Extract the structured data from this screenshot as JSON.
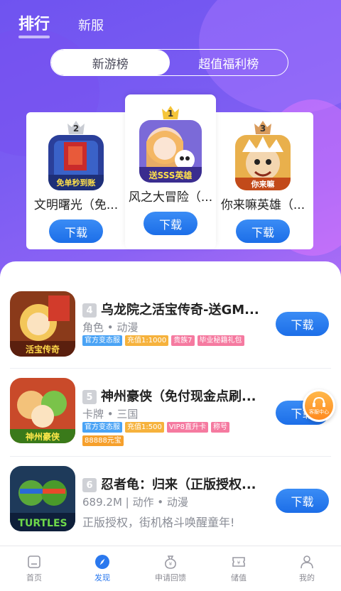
{
  "header": {
    "tab_active": "排行",
    "tab_other": "新服"
  },
  "segment": {
    "left": "新游榜",
    "right": "超值福利榜"
  },
  "podium": [
    {
      "rank": "2",
      "name": "文明曙光（免...",
      "button": "下载",
      "icon_text": "免单秒到账"
    },
    {
      "rank": "1",
      "name": "风之大冒险（...",
      "button": "下载",
      "icon_text": "送SSS英雄"
    },
    {
      "rank": "3",
      "name": "你来嘛英雄（...",
      "button": "下载",
      "icon_text": "你来嘛"
    }
  ],
  "list": [
    {
      "rank": "4",
      "title": "乌龙院之活宝传奇-送GM...",
      "sub": "角色 • 动漫",
      "tags": [
        {
          "text": "官方变态服",
          "color": "#4aa3f5"
        },
        {
          "text": "充值1:1000",
          "color": "#f6b23c"
        },
        {
          "text": "贵族7",
          "color": "#f57aa0"
        },
        {
          "text": "毕业秘籍礼包",
          "color": "#f57aa0"
        }
      ],
      "button": "下载"
    },
    {
      "rank": "5",
      "title": "神州豪侠（免付现金点刷...",
      "sub": "卡牌 • 三国",
      "tags": [
        {
          "text": "官方变态服",
          "color": "#4aa3f5"
        },
        {
          "text": "充值1:500",
          "color": "#f6b23c"
        },
        {
          "text": "VIP8直升卡",
          "color": "#f57aa0"
        },
        {
          "text": "称号",
          "color": "#f57aa0"
        },
        {
          "text": "88888元宝",
          "color": "#f6a02c"
        }
      ],
      "button": "下载"
    },
    {
      "rank": "6",
      "title": "忍者龟：归来（正版授权...",
      "sub": "689.2M | 动作 • 动漫",
      "desc": "正版授权，街机格斗唤醒童年!",
      "button": "下载"
    }
  ],
  "service": {
    "label": "客服中心"
  },
  "bottom_nav": [
    {
      "label": "首页",
      "icon": "home-icon"
    },
    {
      "label": "发现",
      "icon": "compass-icon"
    },
    {
      "label": "申请回馈",
      "icon": "moneybag-icon"
    },
    {
      "label": "储值",
      "icon": "ticket-icon"
    },
    {
      "label": "我的",
      "icon": "user-icon"
    }
  ]
}
